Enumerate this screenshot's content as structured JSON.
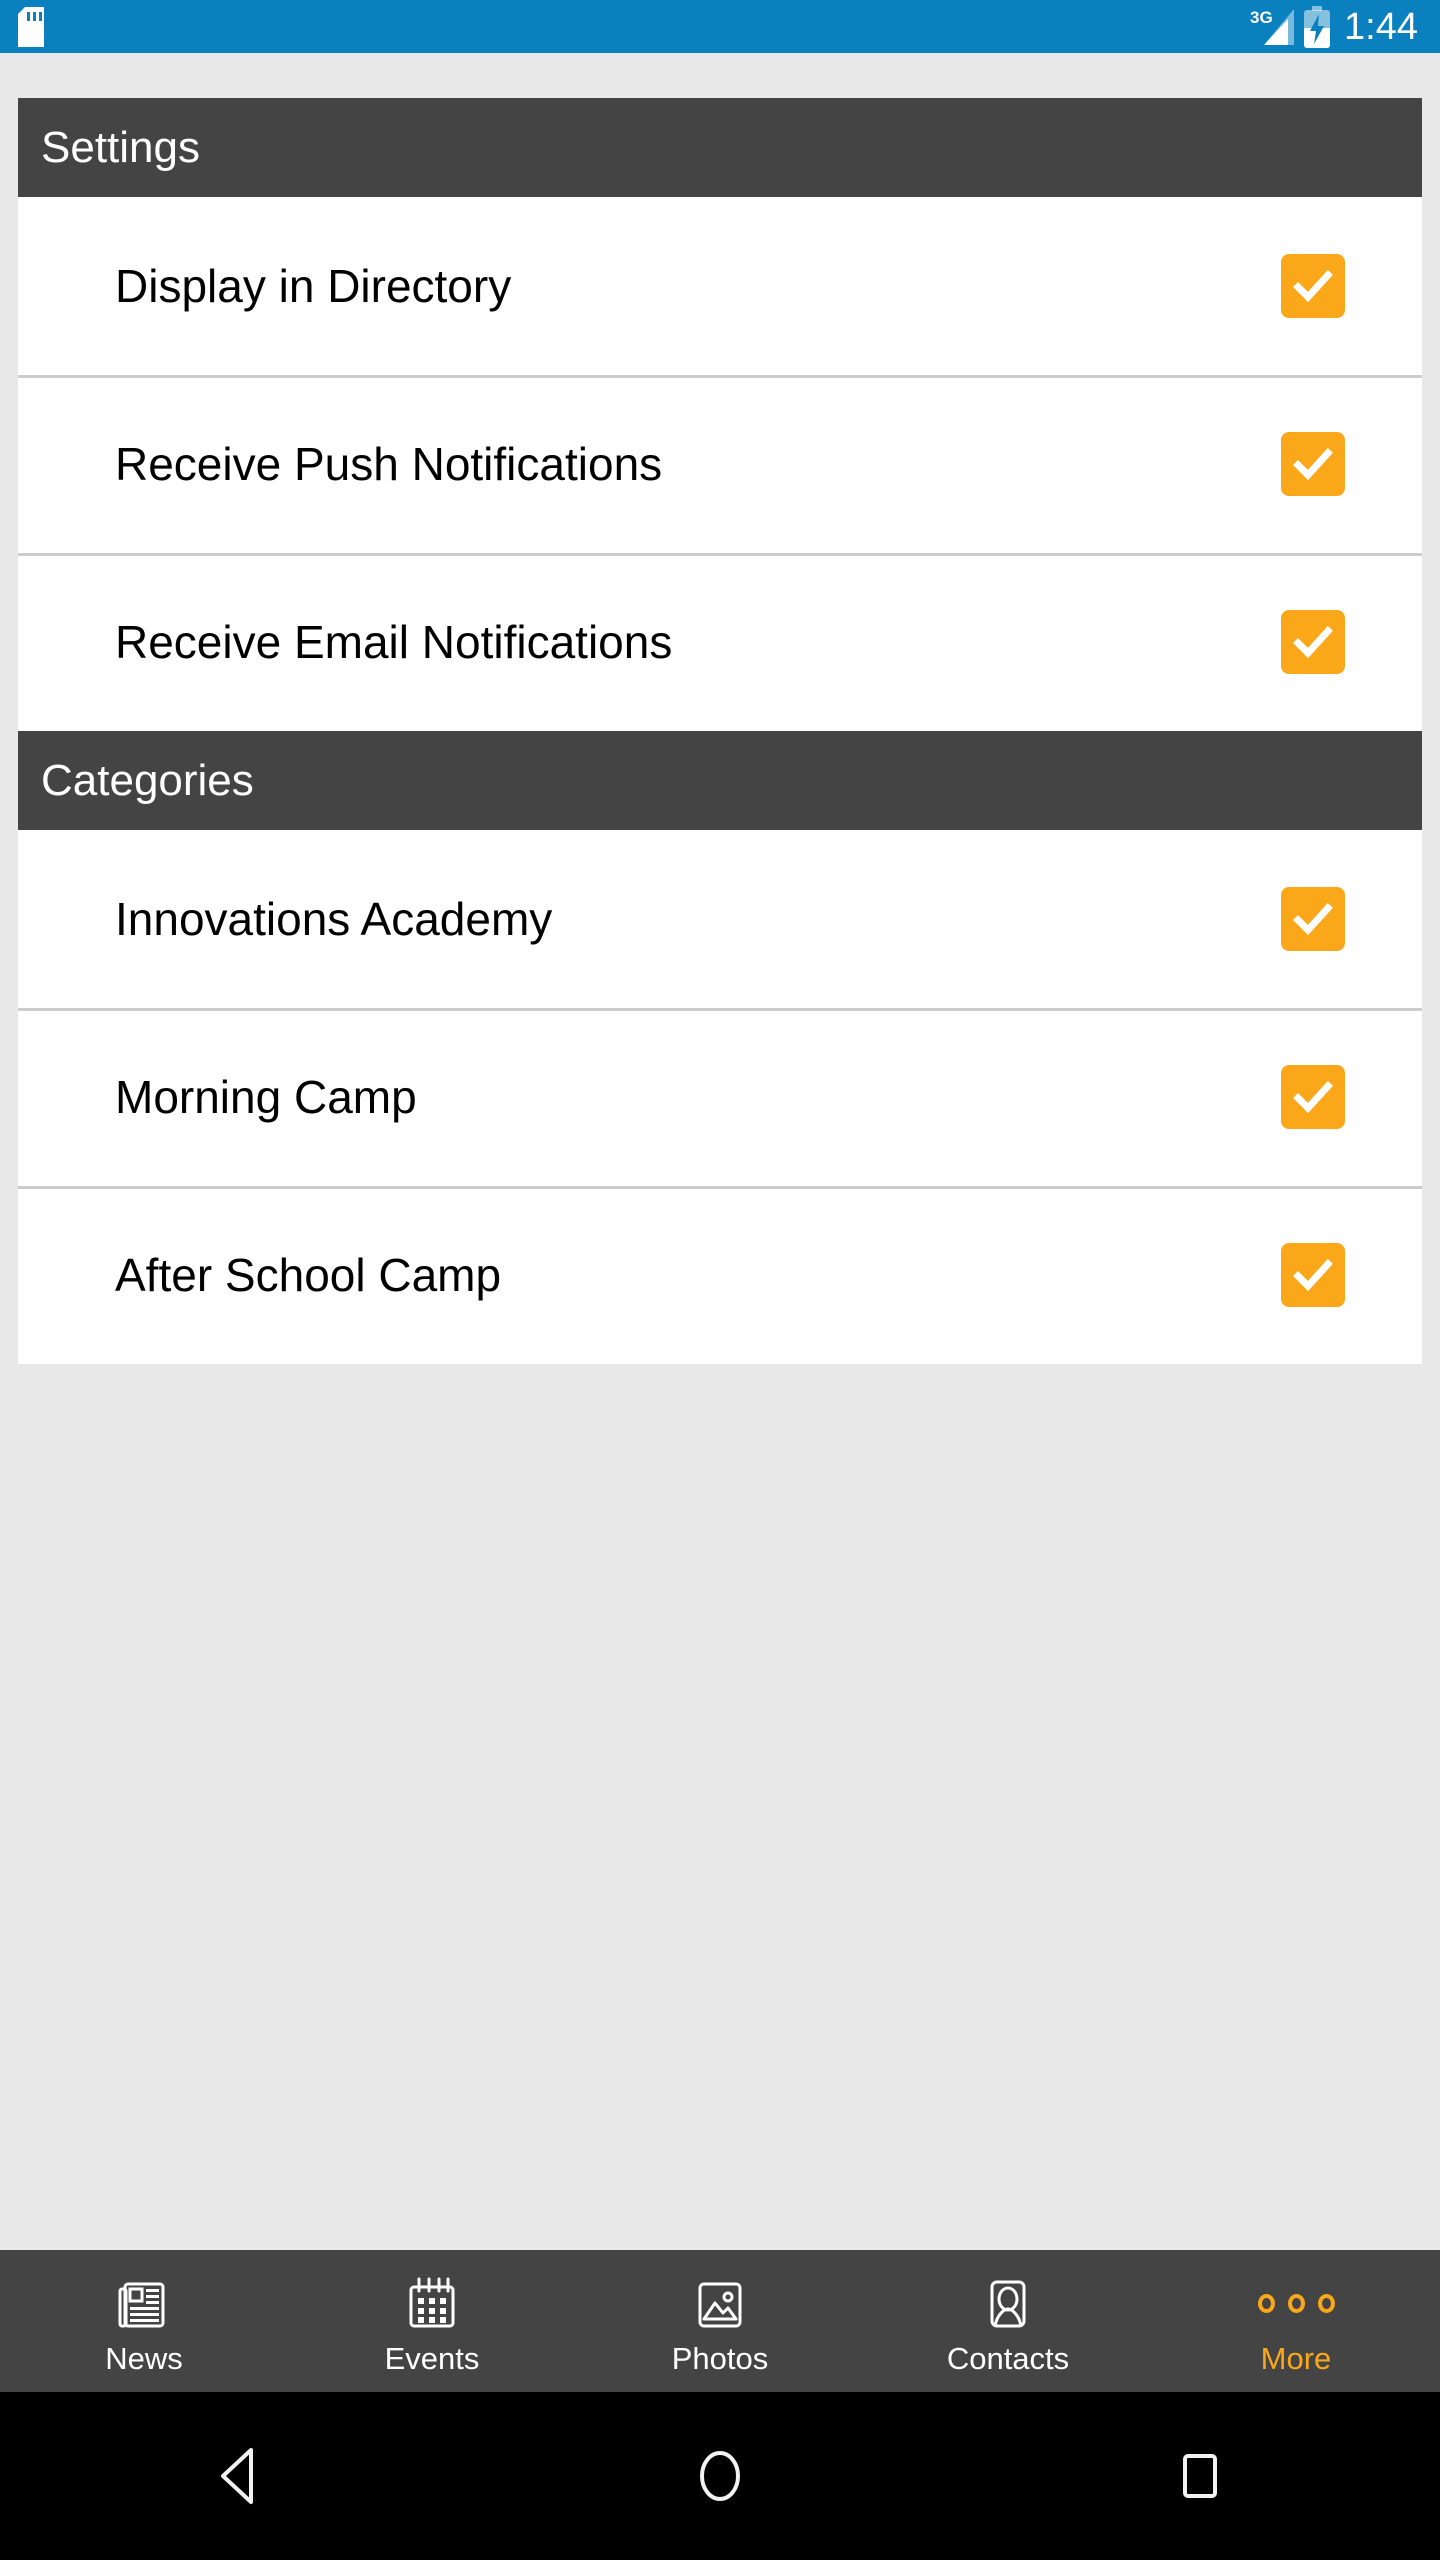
{
  "status_bar": {
    "sd_card_icon": "sd-card-icon",
    "network_label": "3G",
    "signal_icon": "signal-bars-icon",
    "battery_icon": "battery-charging-icon",
    "clock": "1:44",
    "background_color": "#0b80bf"
  },
  "sections": [
    {
      "header": "Settings",
      "rows": [
        {
          "label": "Display in Directory",
          "checked": true
        },
        {
          "label": "Receive Push Notifications",
          "checked": true
        },
        {
          "label": "Receive Email Notifications",
          "checked": true
        }
      ]
    },
    {
      "header": "Categories",
      "rows": [
        {
          "label": "Innovations Academy",
          "checked": true
        },
        {
          "label": "Morning Camp",
          "checked": true
        },
        {
          "label": "After School Camp",
          "checked": true
        }
      ]
    }
  ],
  "theme": {
    "accent_color": "#faa819",
    "header_color": "#444444",
    "page_background": "#e8e8e8",
    "row_background": "#ffffff",
    "divider_color": "#cccccc"
  },
  "tab_bar": {
    "items": [
      {
        "label": "News",
        "icon": "newspaper-icon",
        "active": false
      },
      {
        "label": "Events",
        "icon": "calendar-icon",
        "active": false
      },
      {
        "label": "Photos",
        "icon": "image-icon",
        "active": false
      },
      {
        "label": "Contacts",
        "icon": "person-card-icon",
        "active": false
      },
      {
        "label": "More",
        "icon": "three-dots-icon",
        "active": true
      }
    ]
  },
  "nav_bar": {
    "back": "back-triangle-icon",
    "home": "home-circle-icon",
    "recents": "recents-square-icon"
  }
}
